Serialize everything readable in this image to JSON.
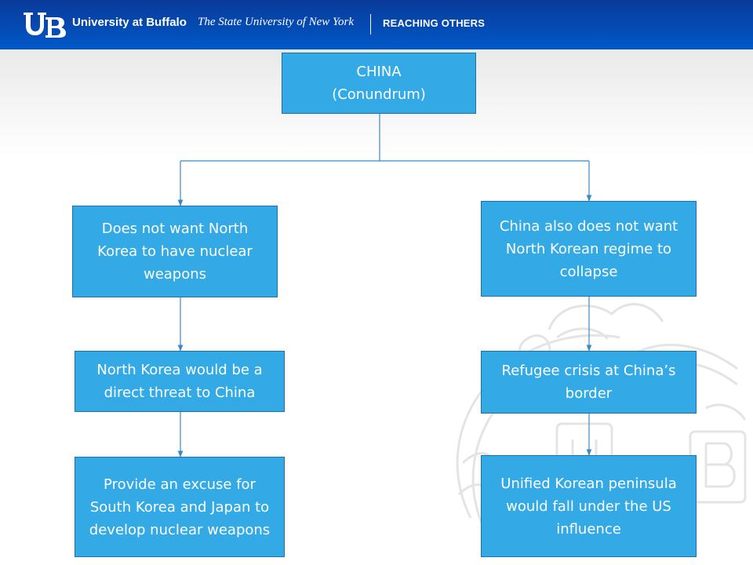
{
  "header": {
    "logo_text": "UB",
    "university": "University at Buffalo",
    "system": "The State University of New York",
    "tagline": "REACHING OTHERS"
  },
  "diagram": {
    "root": {
      "line1": "CHINA",
      "line2": "(Conundrum)"
    },
    "left": [
      "Does not want North Korea to have nuclear weapons",
      "North Korea would be a direct threat to China",
      "Provide an excuse for South Korea and Japan to develop nuclear weapons"
    ],
    "right": [
      "China also does not want North Korean regime to collapse",
      "Refugee crisis at China’s border",
      "Unified Korean peninsula would fall under the US influence"
    ]
  },
  "colors": {
    "banner": "#0059c8",
    "box_fill": "#33a9e6",
    "box_border": "#1f6fa8",
    "connector": "#3a8ac4"
  }
}
